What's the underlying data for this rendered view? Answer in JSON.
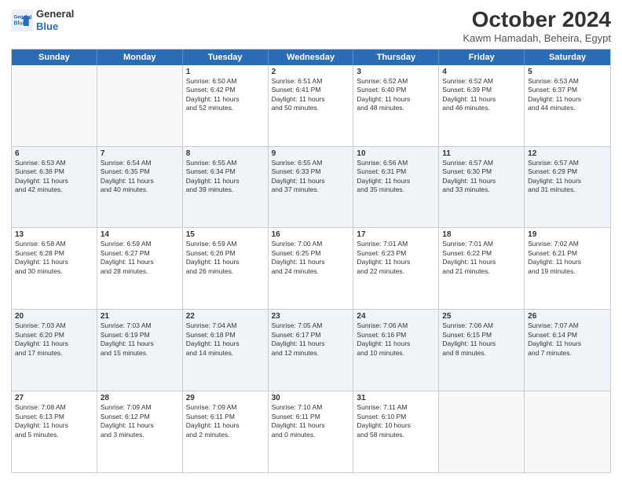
{
  "header": {
    "logo_line1": "General",
    "logo_line2": "Blue",
    "title": "October 2024",
    "location": "Kawm Hamadah, Beheira, Egypt"
  },
  "weekdays": [
    "Sunday",
    "Monday",
    "Tuesday",
    "Wednesday",
    "Thursday",
    "Friday",
    "Saturday"
  ],
  "rows": [
    [
      {
        "day": "",
        "lines": [],
        "empty": true
      },
      {
        "day": "",
        "lines": [],
        "empty": true
      },
      {
        "day": "1",
        "lines": [
          "Sunrise: 6:50 AM",
          "Sunset: 6:42 PM",
          "Daylight: 11 hours",
          "and 52 minutes."
        ]
      },
      {
        "day": "2",
        "lines": [
          "Sunrise: 6:51 AM",
          "Sunset: 6:41 PM",
          "Daylight: 11 hours",
          "and 50 minutes."
        ]
      },
      {
        "day": "3",
        "lines": [
          "Sunrise: 6:52 AM",
          "Sunset: 6:40 PM",
          "Daylight: 11 hours",
          "and 48 minutes."
        ]
      },
      {
        "day": "4",
        "lines": [
          "Sunrise: 6:52 AM",
          "Sunset: 6:39 PM",
          "Daylight: 11 hours",
          "and 46 minutes."
        ]
      },
      {
        "day": "5",
        "lines": [
          "Sunrise: 6:53 AM",
          "Sunset: 6:37 PM",
          "Daylight: 11 hours",
          "and 44 minutes."
        ]
      }
    ],
    [
      {
        "day": "6",
        "lines": [
          "Sunrise: 6:53 AM",
          "Sunset: 6:36 PM",
          "Daylight: 11 hours",
          "and 42 minutes."
        ]
      },
      {
        "day": "7",
        "lines": [
          "Sunrise: 6:54 AM",
          "Sunset: 6:35 PM",
          "Daylight: 11 hours",
          "and 40 minutes."
        ]
      },
      {
        "day": "8",
        "lines": [
          "Sunrise: 6:55 AM",
          "Sunset: 6:34 PM",
          "Daylight: 11 hours",
          "and 39 minutes."
        ]
      },
      {
        "day": "9",
        "lines": [
          "Sunrise: 6:55 AM",
          "Sunset: 6:33 PM",
          "Daylight: 11 hours",
          "and 37 minutes."
        ]
      },
      {
        "day": "10",
        "lines": [
          "Sunrise: 6:56 AM",
          "Sunset: 6:31 PM",
          "Daylight: 11 hours",
          "and 35 minutes."
        ]
      },
      {
        "day": "11",
        "lines": [
          "Sunrise: 6:57 AM",
          "Sunset: 6:30 PM",
          "Daylight: 11 hours",
          "and 33 minutes."
        ]
      },
      {
        "day": "12",
        "lines": [
          "Sunrise: 6:57 AM",
          "Sunset: 6:29 PM",
          "Daylight: 11 hours",
          "and 31 minutes."
        ]
      }
    ],
    [
      {
        "day": "13",
        "lines": [
          "Sunrise: 6:58 AM",
          "Sunset: 6:28 PM",
          "Daylight: 11 hours",
          "and 30 minutes."
        ]
      },
      {
        "day": "14",
        "lines": [
          "Sunrise: 6:59 AM",
          "Sunset: 6:27 PM",
          "Daylight: 11 hours",
          "and 28 minutes."
        ]
      },
      {
        "day": "15",
        "lines": [
          "Sunrise: 6:59 AM",
          "Sunset: 6:26 PM",
          "Daylight: 11 hours",
          "and 26 minutes."
        ]
      },
      {
        "day": "16",
        "lines": [
          "Sunrise: 7:00 AM",
          "Sunset: 6:25 PM",
          "Daylight: 11 hours",
          "and 24 minutes."
        ]
      },
      {
        "day": "17",
        "lines": [
          "Sunrise: 7:01 AM",
          "Sunset: 6:23 PM",
          "Daylight: 11 hours",
          "and 22 minutes."
        ]
      },
      {
        "day": "18",
        "lines": [
          "Sunrise: 7:01 AM",
          "Sunset: 6:22 PM",
          "Daylight: 11 hours",
          "and 21 minutes."
        ]
      },
      {
        "day": "19",
        "lines": [
          "Sunrise: 7:02 AM",
          "Sunset: 6:21 PM",
          "Daylight: 11 hours",
          "and 19 minutes."
        ]
      }
    ],
    [
      {
        "day": "20",
        "lines": [
          "Sunrise: 7:03 AM",
          "Sunset: 6:20 PM",
          "Daylight: 11 hours",
          "and 17 minutes."
        ]
      },
      {
        "day": "21",
        "lines": [
          "Sunrise: 7:03 AM",
          "Sunset: 6:19 PM",
          "Daylight: 11 hours",
          "and 15 minutes."
        ]
      },
      {
        "day": "22",
        "lines": [
          "Sunrise: 7:04 AM",
          "Sunset: 6:18 PM",
          "Daylight: 11 hours",
          "and 14 minutes."
        ]
      },
      {
        "day": "23",
        "lines": [
          "Sunrise: 7:05 AM",
          "Sunset: 6:17 PM",
          "Daylight: 11 hours",
          "and 12 minutes."
        ]
      },
      {
        "day": "24",
        "lines": [
          "Sunrise: 7:06 AM",
          "Sunset: 6:16 PM",
          "Daylight: 11 hours",
          "and 10 minutes."
        ]
      },
      {
        "day": "25",
        "lines": [
          "Sunrise: 7:06 AM",
          "Sunset: 6:15 PM",
          "Daylight: 11 hours",
          "and 8 minutes."
        ]
      },
      {
        "day": "26",
        "lines": [
          "Sunrise: 7:07 AM",
          "Sunset: 6:14 PM",
          "Daylight: 11 hours",
          "and 7 minutes."
        ]
      }
    ],
    [
      {
        "day": "27",
        "lines": [
          "Sunrise: 7:08 AM",
          "Sunset: 6:13 PM",
          "Daylight: 11 hours",
          "and 5 minutes."
        ]
      },
      {
        "day": "28",
        "lines": [
          "Sunrise: 7:09 AM",
          "Sunset: 6:12 PM",
          "Daylight: 11 hours",
          "and 3 minutes."
        ]
      },
      {
        "day": "29",
        "lines": [
          "Sunrise: 7:09 AM",
          "Sunset: 6:11 PM",
          "Daylight: 11 hours",
          "and 2 minutes."
        ]
      },
      {
        "day": "30",
        "lines": [
          "Sunrise: 7:10 AM",
          "Sunset: 6:11 PM",
          "Daylight: 11 hours",
          "and 0 minutes."
        ]
      },
      {
        "day": "31",
        "lines": [
          "Sunrise: 7:11 AM",
          "Sunset: 6:10 PM",
          "Daylight: 10 hours",
          "and 58 minutes."
        ]
      },
      {
        "day": "",
        "lines": [],
        "empty": true
      },
      {
        "day": "",
        "lines": [],
        "empty": true
      }
    ]
  ],
  "alt_rows": [
    1,
    3
  ]
}
